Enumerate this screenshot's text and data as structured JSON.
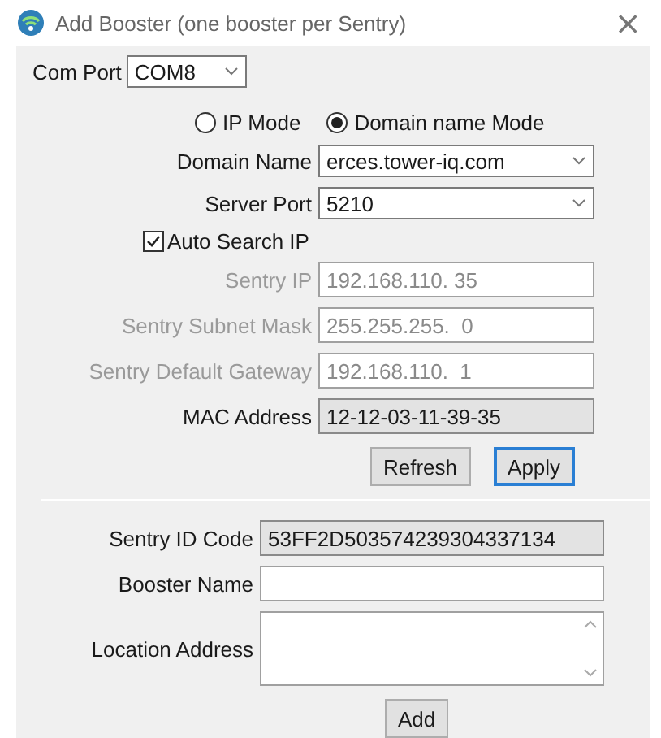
{
  "window": {
    "title": "Add Booster (one booster per Sentry)",
    "close": "×"
  },
  "com_port": {
    "label": "Com Port",
    "value": "COM8"
  },
  "modes": [
    {
      "label": "IP Mode",
      "selected": false
    },
    {
      "label": "Domain name Mode",
      "selected": true
    }
  ],
  "network_fields": [
    {
      "label": "Domain Name",
      "value": "erces.tower-iq.com",
      "kind": "combo",
      "disabled": false
    },
    {
      "label": "Server Port",
      "value": "5210",
      "kind": "combo",
      "disabled": false
    }
  ],
  "auto_search": {
    "label": "Auto Search IP",
    "checked": true
  },
  "ip_fields": [
    {
      "label": "Sentry IP",
      "value": "192.168.110. 35",
      "kind": "text",
      "disabled": true
    },
    {
      "label": "Sentry Subnet Mask",
      "value": "255.255.255.  0",
      "kind": "text",
      "disabled": true
    },
    {
      "label": "Sentry Default Gateway",
      "value": "192.168.110.  1",
      "kind": "text",
      "disabled": true
    },
    {
      "label": "MAC Address",
      "value": "12-12-03-11-39-35",
      "kind": "readonly",
      "disabled": false
    }
  ],
  "network_buttons": [
    {
      "label": "Refresh",
      "selected": false
    },
    {
      "label": "Apply",
      "selected": true
    }
  ],
  "booster_fields": [
    {
      "label": "Sentry ID Code",
      "value": "53FF2D503574239304337134",
      "kind": "readonly"
    },
    {
      "label": "Booster Name",
      "kind": "text"
    },
    {
      "label": "Location Address",
      "kind": "memo"
    }
  ],
  "add_button": "Add"
}
